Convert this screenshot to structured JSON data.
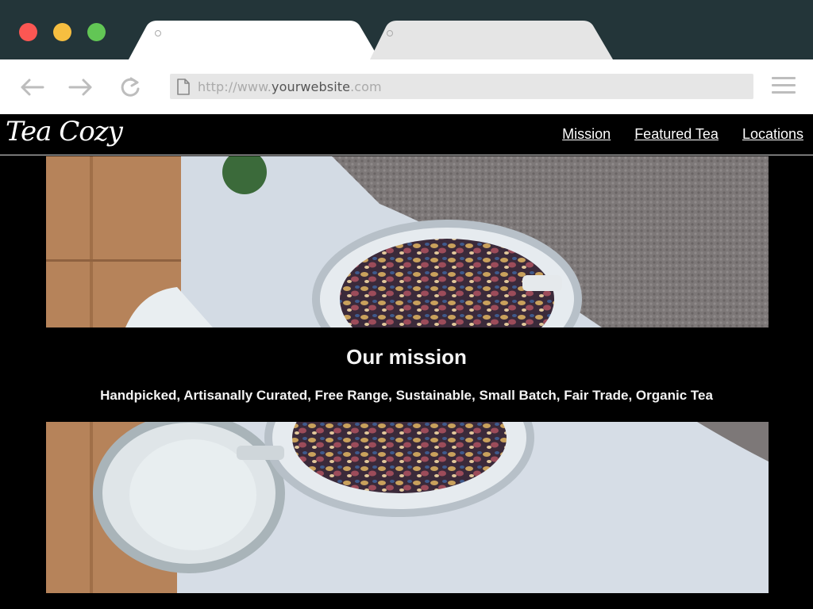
{
  "browser": {
    "url_prefix": "http://www.",
    "url_domain": "yourwebsite",
    "url_suffix": ".com"
  },
  "site": {
    "logo": "Tea Cozy",
    "nav": [
      "Mission",
      "Featured Tea",
      "Locations"
    ]
  },
  "mission": {
    "title": "Our mission",
    "tagline": "Handpicked, Artisanally Curated, Free Range, Sustainable, Small Batch, Fair Trade, Organic Tea"
  },
  "colors": {
    "titlebar": "#233539",
    "close": "#fc5753",
    "minimize": "#f6be40",
    "maximize": "#62c655",
    "page_background": "#000000",
    "text": "#ffffff"
  }
}
